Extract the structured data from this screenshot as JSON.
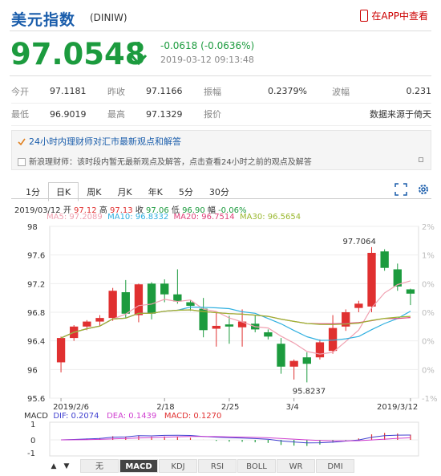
{
  "header": {
    "title": "美元指数",
    "code": "(DINIW)",
    "app_link": "在APP中查看"
  },
  "quote": {
    "price": "97.0548",
    "change": "-0.0618 (-0.0636%)",
    "datetime": "2019-03-12 09:13:48"
  },
  "stats": {
    "row1": [
      {
        "label": "今开",
        "value": "97.1181"
      },
      {
        "label": "昨收",
        "value": "97.1166"
      },
      {
        "label": "振幅",
        "value": "0.2379%"
      },
      {
        "label": "波幅",
        "value": "0.231"
      }
    ],
    "row2": [
      {
        "label": "最低",
        "value": "96.9019"
      },
      {
        "label": "最高",
        "value": "97.1329"
      },
      {
        "label": "报价",
        "value": "数据来源于倚天"
      }
    ]
  },
  "news": {
    "headline": "24小时内理财师对汇市最新观点和解答",
    "body": "新浪理财师：该时段内暂无最新观点及解答，点击查看24小时之前的观点及解答"
  },
  "tabs": [
    "1分",
    "日K",
    "周K",
    "月K",
    "年K",
    "5分",
    "30分"
  ],
  "active_tab": "日K",
  "ohlc": {
    "date": "2019/03/12",
    "open_label": "开",
    "open": "97.12",
    "high_label": "高",
    "high": "97.13",
    "close_label": "收",
    "close": "97.06",
    "low_label": "低",
    "low": "96.90",
    "range_label": "幅",
    "range": "-0.06%"
  },
  "ma": {
    "ma5": "MA5: 97.2089",
    "ma10": "MA10: 96.8332",
    "ma20": "MA20: 96.7514",
    "ma30": "MA30: 96.5654"
  },
  "macd": {
    "label": "MACD",
    "dif": "DIF: 0.2074",
    "dea": "DEA: 0.1439",
    "macd": "MACD: 0.1270"
  },
  "colors": {
    "up": "#e03030",
    "down": "#1c9b3e",
    "ma5": "#f0a0b0",
    "ma10": "#30b0e0",
    "ma20": "#e0407a",
    "ma30": "#9ab830",
    "dif": "#4040d0",
    "dea": "#d040d0"
  },
  "chart_data": {
    "type": "candlestick",
    "y_ticks": [
      "98",
      "97.6",
      "97.2",
      "96.8",
      "96.4",
      "96",
      "95.6"
    ],
    "pct_ticks": [
      "2%",
      "1%",
      "0%",
      "0%",
      "0%",
      "0%",
      "-1%"
    ],
    "x_ticks": [
      "2019/2/6",
      "2/18",
      "2/25",
      "3/4",
      "2019/3/12"
    ],
    "ylim": [
      95.6,
      98.0
    ],
    "max_label": "97.7064",
    "min_label": "95.8237",
    "candles": [
      {
        "o": 96.1,
        "c": 96.44,
        "h": 96.46,
        "l": 95.96
      },
      {
        "o": 96.44,
        "c": 96.6,
        "h": 96.62,
        "l": 96.4
      },
      {
        "o": 96.6,
        "c": 96.67,
        "h": 96.69,
        "l": 96.55
      },
      {
        "o": 96.67,
        "c": 96.72,
        "h": 96.76,
        "l": 96.6
      },
      {
        "o": 96.72,
        "c": 97.1,
        "h": 97.14,
        "l": 96.68
      },
      {
        "o": 97.08,
        "c": 96.78,
        "h": 97.25,
        "l": 96.72
      },
      {
        "o": 96.76,
        "c": 97.19,
        "h": 97.2,
        "l": 96.66
      },
      {
        "o": 97.2,
        "c": 96.78,
        "h": 97.22,
        "l": 96.7
      },
      {
        "o": 97.2,
        "c": 97.05,
        "h": 97.26,
        "l": 96.94
      },
      {
        "o": 97.05,
        "c": 96.95,
        "h": 97.4,
        "l": 96.92
      },
      {
        "o": 96.94,
        "c": 96.89,
        "h": 96.97,
        "l": 96.82
      },
      {
        "o": 96.85,
        "c": 96.55,
        "h": 97.0,
        "l": 96.45
      },
      {
        "o": 96.57,
        "c": 96.61,
        "h": 96.8,
        "l": 96.32
      },
      {
        "o": 96.63,
        "c": 96.6,
        "h": 96.75,
        "l": 96.36
      },
      {
        "o": 96.59,
        "c": 96.67,
        "h": 96.84,
        "l": 96.32
      },
      {
        "o": 96.64,
        "c": 96.56,
        "h": 96.76,
        "l": 96.52
      },
      {
        "o": 96.52,
        "c": 96.46,
        "h": 96.56,
        "l": 96.42
      },
      {
        "o": 96.36,
        "c": 96.04,
        "h": 96.44,
        "l": 95.94
      },
      {
        "o": 96.04,
        "c": 96.12,
        "h": 96.14,
        "l": 95.86
      },
      {
        "o": 96.17,
        "c": 96.08,
        "h": 96.24,
        "l": 95.82
      },
      {
        "o": 96.17,
        "c": 96.38,
        "h": 96.42,
        "l": 96.14
      },
      {
        "o": 96.26,
        "c": 96.58,
        "h": 96.76,
        "l": 96.22
      },
      {
        "o": 96.6,
        "c": 96.8,
        "h": 96.84,
        "l": 96.54
      },
      {
        "o": 96.86,
        "c": 96.92,
        "h": 96.96,
        "l": 96.8
      },
      {
        "o": 96.88,
        "c": 97.63,
        "h": 97.71,
        "l": 96.8
      },
      {
        "o": 97.65,
        "c": 97.42,
        "h": 97.68,
        "l": 97.38
      },
      {
        "o": 97.4,
        "c": 97.16,
        "h": 97.48,
        "l": 97.1
      },
      {
        "o": 97.12,
        "c": 97.06,
        "h": 97.13,
        "l": 96.9
      }
    ]
  }
}
